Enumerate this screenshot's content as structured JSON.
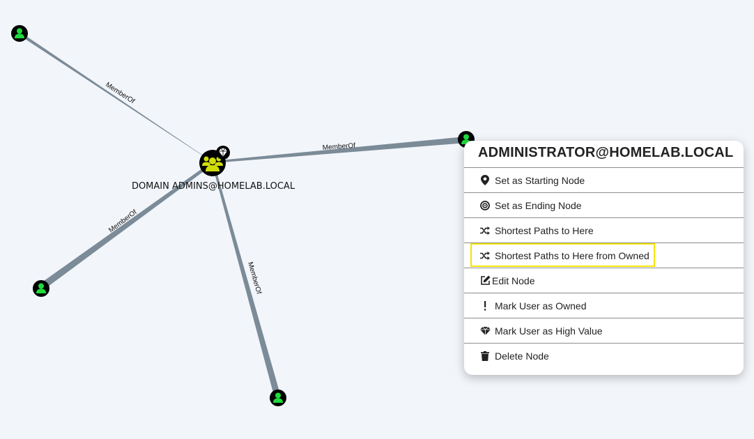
{
  "graph": {
    "center_node": {
      "label": "DOMAIN ADMINS@HOMELAB.LOCAL",
      "icon": "group-icon",
      "badge": "high-value-diamond-icon"
    },
    "user_nodes_icon": "user-icon",
    "edges": [
      {
        "label": "MemberOf"
      },
      {
        "label": "MemberOf"
      },
      {
        "label": "MemberOf"
      },
      {
        "label": "MemberOf"
      }
    ],
    "colors": {
      "edge": "#7b8b97",
      "user_fill": "#1fdb3c",
      "group_fill": "#cfde0a",
      "node_bg": "#000000"
    }
  },
  "context_menu": {
    "title": "ADMINISTRATOR@HOMELAB.LOCAL",
    "items": [
      {
        "label": "Set as Starting Node",
        "icon": "map-pin-icon"
      },
      {
        "label": "Set as Ending Node",
        "icon": "target-icon"
      },
      {
        "label": "Shortest Paths to Here",
        "icon": "shuffle-icon"
      },
      {
        "label": "Shortest Paths to Here from Owned",
        "icon": "shuffle-icon",
        "highlighted": true
      },
      {
        "label": "Edit Node",
        "icon": "edit-icon"
      },
      {
        "label": "Mark User as Owned",
        "icon": "exclamation-icon"
      },
      {
        "label": "Mark User as High Value",
        "icon": "gem-icon"
      },
      {
        "label": "Delete Node",
        "icon": "trash-icon"
      }
    ],
    "highlight_color": "#f2e40b"
  }
}
